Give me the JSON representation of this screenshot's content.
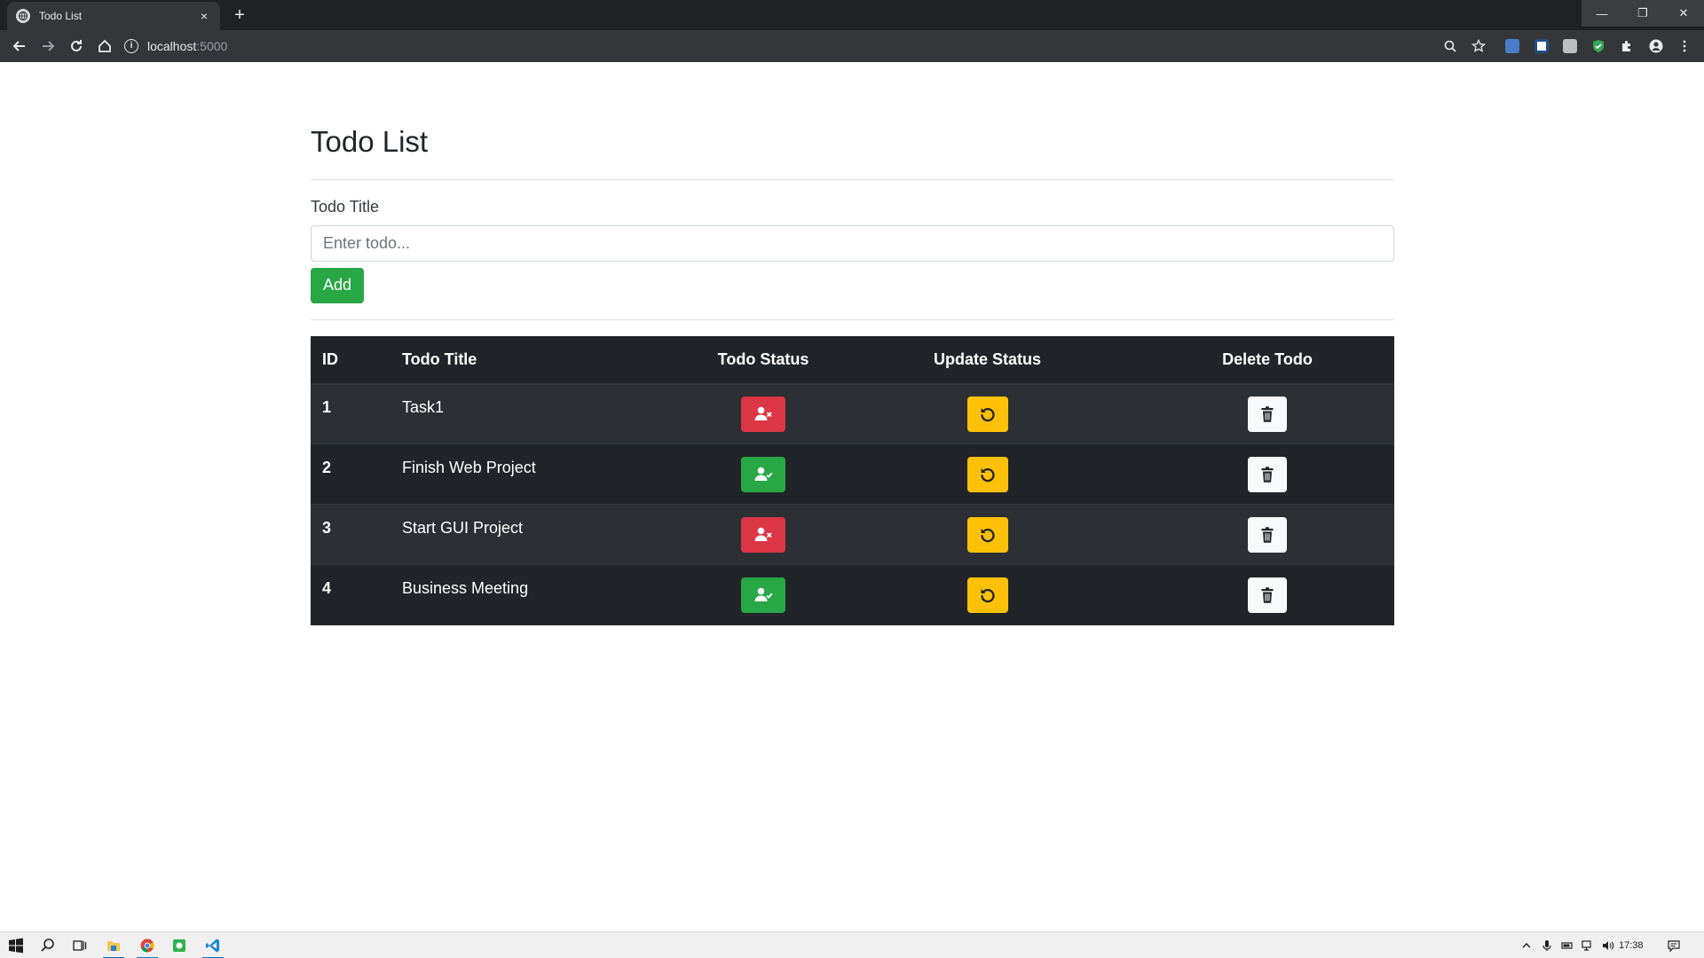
{
  "browser": {
    "tab_title": "Todo List",
    "tab_close": "×",
    "new_tab": "+",
    "url_host": "localhost",
    "url_port": ":5000",
    "window_controls": {
      "minimize": "—",
      "maximize": "❐",
      "close": "✕"
    }
  },
  "page": {
    "title": "Todo List",
    "form": {
      "label": "Todo Title",
      "placeholder": "Enter todo...",
      "value": "",
      "add_label": "Add"
    },
    "table": {
      "headers": [
        "ID",
        "Todo Title",
        "Todo Status",
        "Update Status",
        "Delete Todo"
      ],
      "rows": [
        {
          "id": "1",
          "title": "Task1",
          "status": "incomplete",
          "status_icon": "user-times-icon",
          "status_color": "#dc3545"
        },
        {
          "id": "2",
          "title": "Finish Web Project",
          "status": "complete",
          "status_icon": "user-check-icon",
          "status_color": "#28a745"
        },
        {
          "id": "3",
          "title": "Start GUI Project",
          "status": "incomplete",
          "status_icon": "user-times-icon",
          "status_color": "#dc3545"
        },
        {
          "id": "4",
          "title": "Business Meeting",
          "status": "complete",
          "status_icon": "user-check-icon",
          "status_color": "#28a745"
        }
      ],
      "update_icon": "undo-icon",
      "update_color": "#ffc107",
      "delete_icon": "trash-icon",
      "delete_color": "#f8f9fa"
    }
  },
  "taskbar": {
    "clock": "17:38",
    "pinned": [
      "windows-start-icon",
      "search-icon",
      "task-view-icon",
      "file-explorer-icon",
      "chrome-icon",
      "app-green-icon",
      "vscode-icon"
    ]
  },
  "colors": {
    "table_bg": "#212529",
    "accent_green": "#28a745",
    "accent_red": "#dc3545",
    "accent_yellow": "#ffc107"
  }
}
